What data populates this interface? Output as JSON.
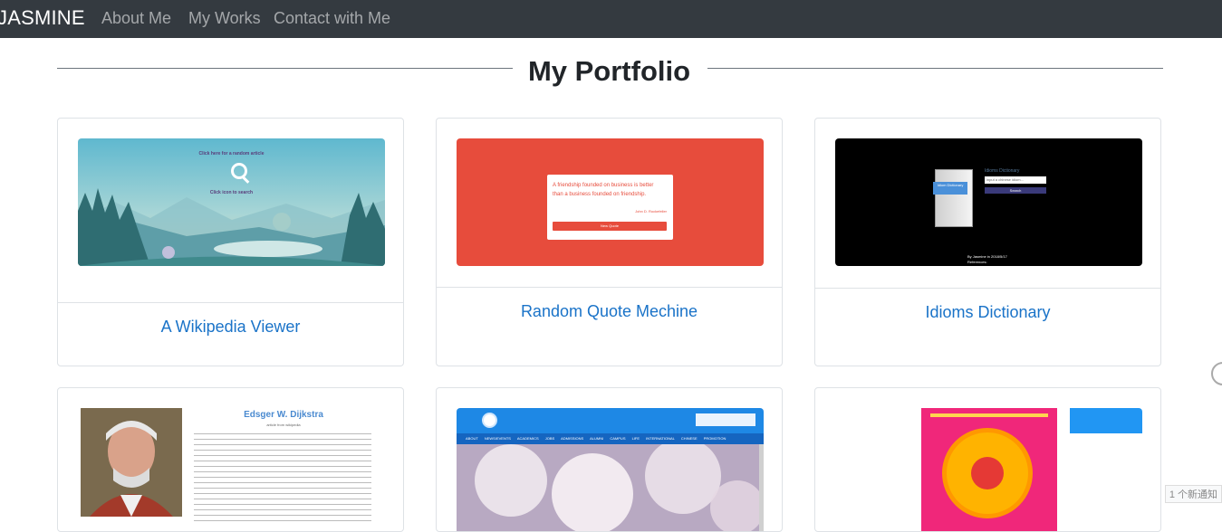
{
  "navbar": {
    "brand": "JASMINE",
    "links": [
      "About Me",
      "My Works",
      "Contact with Me"
    ]
  },
  "main": {
    "heading": "My Portfolio",
    "cards": [
      {
        "title": "A Wikipedia Viewer",
        "thumb": {
          "line1": "Click here for a random article",
          "line2": "Click icon to search"
        }
      },
      {
        "title": "Random Quote Mechine",
        "thumb": {
          "quote": "A friendship founded on business is better than a business founded on friendship.",
          "author": "John D. Rockefeller",
          "button": "New Quote"
        }
      },
      {
        "title": "Idioms Dictionary",
        "thumb": {
          "app_title": "Idioms Dictionary",
          "placeholder": "input a chinese idiom...",
          "button": "Search",
          "book": "Idiom Dictionary",
          "footer1": "By Jasmine in 2018/5/17",
          "footer2": "References:"
        }
      },
      {
        "title": "",
        "thumb": {
          "name": "Edsger W. Dijkstra",
          "sub": "article from wikipedia"
        }
      },
      {
        "title": "",
        "thumb": {
          "menu": [
            "ABOUT",
            "NEWS/EVENTS",
            "ACADEMICS",
            "JOBS",
            "ADMISSIONS",
            "ALUMNI",
            "CAMPUS LIFE",
            "INTERNATIONAL",
            "CHINESE PROMOTION"
          ]
        }
      },
      {
        "title": "",
        "thumb": {}
      }
    ]
  },
  "edge": {
    "badge": "1 个新通知"
  }
}
